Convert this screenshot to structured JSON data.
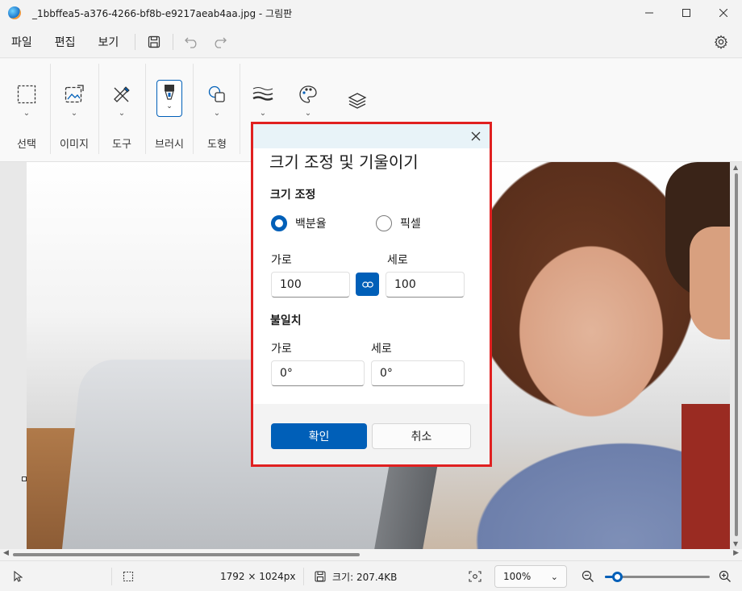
{
  "window": {
    "title": "_1bbffea5-a376-4266-bf8b-e9217aeab4aa.jpg - 그림판"
  },
  "menu": {
    "items": [
      "파일",
      "편집",
      "보기"
    ]
  },
  "ribbon": {
    "groups": [
      {
        "label": "선택",
        "icon": "selection-icon"
      },
      {
        "label": "이미지",
        "icon": "image-icon"
      },
      {
        "label": "도구",
        "icon": "tools-icon"
      },
      {
        "label": "브러시",
        "icon": "brush-icon"
      },
      {
        "label": "도형",
        "icon": "shapes-icon"
      },
      {
        "label": "",
        "icon": "line-size-icon"
      },
      {
        "label": "",
        "icon": "palette-icon"
      },
      {
        "label": "",
        "icon": "layers-icon"
      }
    ]
  },
  "dialog": {
    "title": "크기 조정 및 기울이기",
    "resize": {
      "heading": "크기 조정",
      "option_percent": "백분율",
      "option_pixel": "픽셀",
      "selected": "percent",
      "horizontal_label": "가로",
      "vertical_label": "세로",
      "horizontal_value": "100",
      "vertical_value": "100"
    },
    "skew": {
      "heading": "불일치",
      "horizontal_label": "가로",
      "vertical_label": "세로",
      "horizontal_value": "0°",
      "vertical_value": "0°"
    },
    "ok_label": "확인",
    "cancel_label": "취소"
  },
  "status": {
    "dimensions": "1792 × 1024px",
    "size": "크기: 207.4KB",
    "zoom": "100%",
    "zoom_level": 0.1
  },
  "colors": {
    "accent": "#005fb8",
    "highlight_border": "#e02020"
  }
}
